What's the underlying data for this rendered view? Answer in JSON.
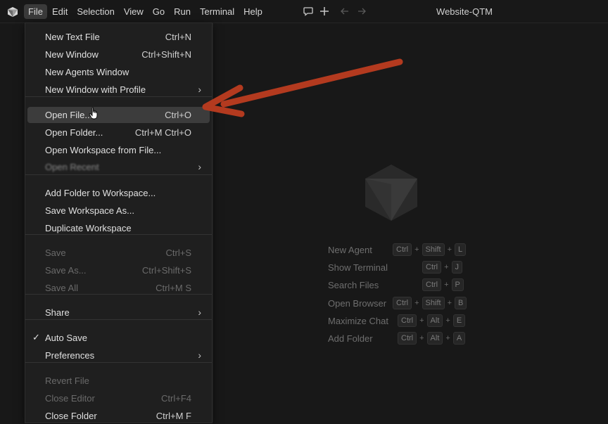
{
  "window": {
    "title": "Website-QTM"
  },
  "menubar": {
    "items": [
      "File",
      "Edit",
      "Selection",
      "View",
      "Go",
      "Run",
      "Terminal",
      "Help"
    ],
    "active": "File"
  },
  "titlebar_icons": [
    "chat-bubble-icon",
    "plus-icon",
    "arrow-left-icon",
    "arrow-right-icon"
  ],
  "file_menu": {
    "items": [
      {
        "label": "New Text File",
        "shortcut": "Ctrl+N"
      },
      {
        "label": "New Window",
        "shortcut": "Ctrl+Shift+N"
      },
      {
        "label": "New Agents Window",
        "shortcut": ""
      },
      {
        "label": "New Window with Profile",
        "shortcut": "",
        "submenu": true
      },
      {
        "label": "Open File...",
        "shortcut": "Ctrl+O",
        "highlighted": true
      },
      {
        "label": "Open Folder...",
        "shortcut": "Ctrl+M Ctrl+O"
      },
      {
        "label": "Open Workspace from File...",
        "shortcut": ""
      },
      {
        "label": "Open Recent",
        "shortcut": "",
        "submenu": true,
        "obscured": true
      },
      {
        "label": "Add Folder to Workspace...",
        "shortcut": ""
      },
      {
        "label": "Save Workspace As...",
        "shortcut": ""
      },
      {
        "label": "Duplicate Workspace",
        "shortcut": ""
      },
      {
        "label": "Save",
        "shortcut": "Ctrl+S",
        "disabled": true
      },
      {
        "label": "Save As...",
        "shortcut": "Ctrl+Shift+S",
        "disabled": true
      },
      {
        "label": "Save All",
        "shortcut": "Ctrl+M S",
        "disabled": true
      },
      {
        "label": "Share",
        "shortcut": "",
        "submenu": true
      },
      {
        "label": "Auto Save",
        "shortcut": "",
        "checked": true
      },
      {
        "label": "Preferences",
        "shortcut": "",
        "submenu": true
      },
      {
        "label": "Revert File",
        "shortcut": "",
        "disabled": true
      },
      {
        "label": "Close Editor",
        "shortcut": "Ctrl+F4",
        "disabled": true
      },
      {
        "label": "Close Folder",
        "shortcut": "Ctrl+M F"
      }
    ]
  },
  "shortcuts": [
    {
      "name": "New Agent",
      "keys": [
        "Ctrl",
        "Shift",
        "L"
      ]
    },
    {
      "name": "Show Terminal",
      "keys": [
        "Ctrl",
        "J"
      ]
    },
    {
      "name": "Search Files",
      "keys": [
        "Ctrl",
        "P"
      ]
    },
    {
      "name": "Open Browser",
      "keys": [
        "Ctrl",
        "Shift",
        "B"
      ]
    },
    {
      "name": "Maximize Chat",
      "keys": [
        "Ctrl",
        "Alt",
        "E"
      ]
    },
    {
      "name": "Add Folder",
      "keys": [
        "Ctrl",
        "Alt",
        "A"
      ]
    }
  ],
  "colors": {
    "background": "#181818",
    "menu_background": "#1f1f1f",
    "highlight": "#3c3c3c",
    "annotation_arrow": "#b33a1f"
  }
}
